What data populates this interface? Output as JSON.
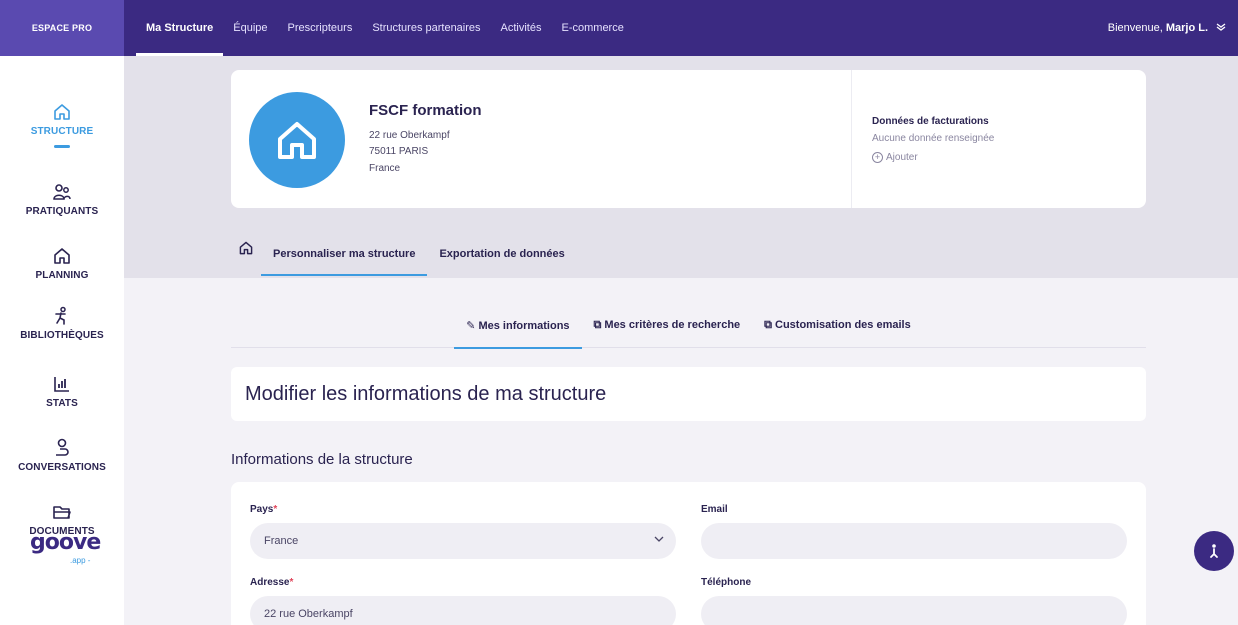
{
  "topbar": {
    "brand": "ESPACE PRO",
    "nav": [
      "Ma Structure",
      "Équipe",
      "Prescripteurs",
      "Structures partenaires",
      "Activités",
      "E-commerce"
    ],
    "welcome_prefix": "Bienvenue,",
    "user_name": "Marjo L."
  },
  "sidebar": {
    "items": [
      {
        "label": "STRUCTURE",
        "icon": "home-icon"
      },
      {
        "label": "PRATIQUANTS",
        "icon": "people-icon"
      },
      {
        "label": "PLANNING",
        "icon": "home-icon"
      },
      {
        "label": "BIBLIOTHÈQUES",
        "icon": "runner-icon"
      },
      {
        "label": "STATS",
        "icon": "bar-chart-icon"
      },
      {
        "label": "CONVERSATIONS",
        "icon": "chat-icon"
      },
      {
        "label": "DOCUMENTS",
        "icon": "folder-icon"
      }
    ],
    "logo": "goove",
    "logo_tag": ".app -"
  },
  "structure": {
    "name": "FSCF formation",
    "address1": "22 rue Oberkampf",
    "address2": "75011 PARIS",
    "country": "France"
  },
  "billing": {
    "title": "Données de facturations",
    "subtitle": "Aucune donnée renseignée",
    "add": "Ajouter"
  },
  "tabs": [
    "Personnaliser ma structure",
    "Exportation de données"
  ],
  "subtabs": [
    "Mes informations",
    "Mes critères de recherche",
    "Customisation des emails"
  ],
  "page_title": "Modifier les informations de ma structure",
  "section_title": "Informations de la structure",
  "form": {
    "pays_label": "Pays",
    "pays_value": "France",
    "email_label": "Email",
    "email_value": "",
    "adresse_label": "Adresse",
    "adresse_value": "22 rue Oberkampf",
    "telephone_label": "Téléphone",
    "telephone_value": "",
    "required_mark": "*"
  },
  "colors": {
    "topbar": "#3b2a82",
    "brand": "#5a4ab0",
    "accent": "#3c9be0"
  }
}
